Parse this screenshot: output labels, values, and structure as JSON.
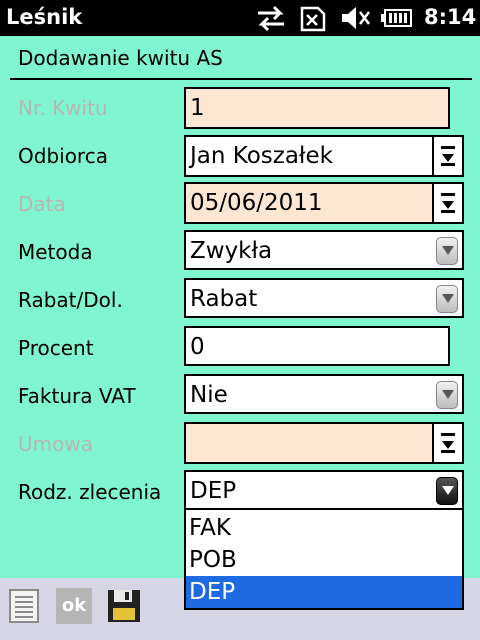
{
  "statusbar": {
    "app_title": "Leśnik",
    "time": "8:14",
    "icons": [
      "data-transfer-icon",
      "no-sim-icon",
      "speaker-muted-icon",
      "battery-icon"
    ]
  },
  "page": {
    "title": "Dodawanie kwitu AS"
  },
  "form": {
    "nr_kwitu": {
      "label": "Nr. Kwitu",
      "value": "1"
    },
    "odbiorca": {
      "label": "Odbiorca",
      "value": "Jan Koszałek"
    },
    "data": {
      "label": "Data",
      "value": "05/06/2011"
    },
    "metoda": {
      "label": "Metoda",
      "value": "Zwykła"
    },
    "rabat": {
      "label": "Rabat/Dol.",
      "value": "Rabat"
    },
    "procent": {
      "label": "Procent",
      "value": "0"
    },
    "faktura": {
      "label": "Faktura VAT",
      "value": "Nie"
    },
    "umowa": {
      "label": "Umowa",
      "value": ""
    },
    "rodz": {
      "label": "Rodz. zlecenia",
      "value": "DEP",
      "options": [
        "FAK",
        "POB",
        "DEP"
      ]
    }
  },
  "toolbar": {
    "ok_label": "ok",
    "icons": [
      "list-icon",
      "ok-icon",
      "save-icon"
    ]
  },
  "colors": {
    "background": "#7ff5d0",
    "readonly_field": "#fde7d3",
    "selection": "#1e6ae0",
    "disabled_label": "#b7b7b7",
    "toolbar": "#d6d6e7"
  }
}
